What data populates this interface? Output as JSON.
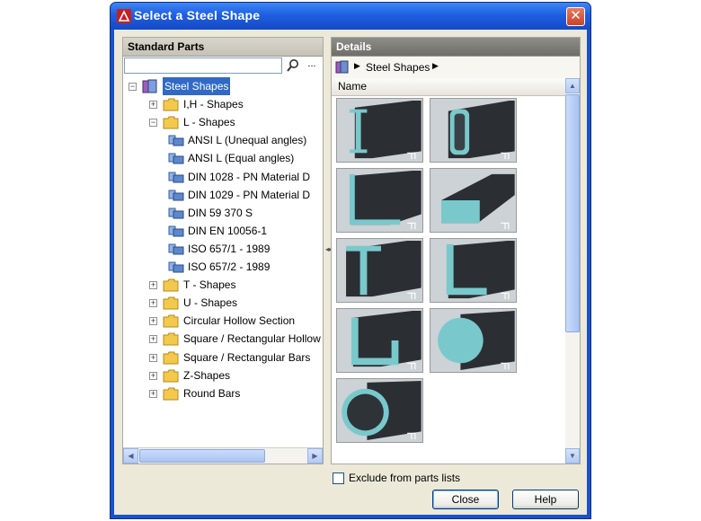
{
  "window": {
    "title": "Select a Steel Shape"
  },
  "left_panel": {
    "header": "Standard Parts",
    "search": {
      "value": "",
      "more_label": "..."
    },
    "tree": [
      {
        "label": "Steel Shapes",
        "level": 0,
        "expander": "-",
        "icon": "library-icon",
        "selected": true
      },
      {
        "label": "I,H - Shapes",
        "level": 1,
        "expander": "+",
        "icon": "folder-icon"
      },
      {
        "label": "L - Shapes",
        "level": 1,
        "expander": "-",
        "icon": "folder-icon"
      },
      {
        "label": "ANSI L  (Unequal angles)",
        "level": 2,
        "icon": "part-family-icon"
      },
      {
        "label": "ANSI L  (Equal angles)",
        "level": 2,
        "icon": "part-family-icon"
      },
      {
        "label": "DIN 1028 - PN Material D",
        "level": 2,
        "icon": "part-family-icon"
      },
      {
        "label": "DIN 1029 - PN Material D",
        "level": 2,
        "icon": "part-family-icon"
      },
      {
        "label": "DIN 59 370  S",
        "level": 2,
        "icon": "part-family-icon"
      },
      {
        "label": "DIN EN 10056-1",
        "level": 2,
        "icon": "part-family-icon"
      },
      {
        "label": "ISO 657/1 - 1989",
        "level": 2,
        "icon": "part-family-icon"
      },
      {
        "label": "ISO 657/2 - 1989",
        "level": 2,
        "icon": "part-family-icon"
      },
      {
        "label": "T - Shapes",
        "level": 1,
        "expander": "+",
        "icon": "folder-icon"
      },
      {
        "label": "U - Shapes",
        "level": 1,
        "expander": "+",
        "icon": "folder-icon"
      },
      {
        "label": "Circular Hollow Section",
        "level": 1,
        "expander": "+",
        "icon": "folder-icon"
      },
      {
        "label": "Square / Rectangular Hollow S",
        "level": 1,
        "expander": "+",
        "icon": "folder-icon"
      },
      {
        "label": "Square / Rectangular Bars",
        "level": 1,
        "expander": "+",
        "icon": "folder-icon"
      },
      {
        "label": "Z-Shapes",
        "level": 1,
        "expander": "+",
        "icon": "folder-icon"
      },
      {
        "label": "Round Bars",
        "level": 1,
        "expander": "+",
        "icon": "folder-icon"
      }
    ]
  },
  "right_panel": {
    "header": "Details",
    "breadcrumb": "Steel Shapes",
    "column_header": "Name",
    "tiles": [
      {
        "shape": "i-beam"
      },
      {
        "shape": "rectangular-hollow"
      },
      {
        "shape": "angle-l"
      },
      {
        "shape": "flat-bar"
      },
      {
        "shape": "tee"
      },
      {
        "shape": "tee-alt"
      },
      {
        "shape": "channel"
      },
      {
        "shape": "round-bar"
      },
      {
        "shape": "circular-hollow"
      }
    ]
  },
  "exclude_label": "Exclude from parts lists",
  "buttons": {
    "close": "Close",
    "help": "Help"
  },
  "colors": {
    "titlebar": "#1f5fe0",
    "selection": "#316ac5",
    "steel_face": "#79c9cc",
    "steel_body": "#2b2f33"
  }
}
